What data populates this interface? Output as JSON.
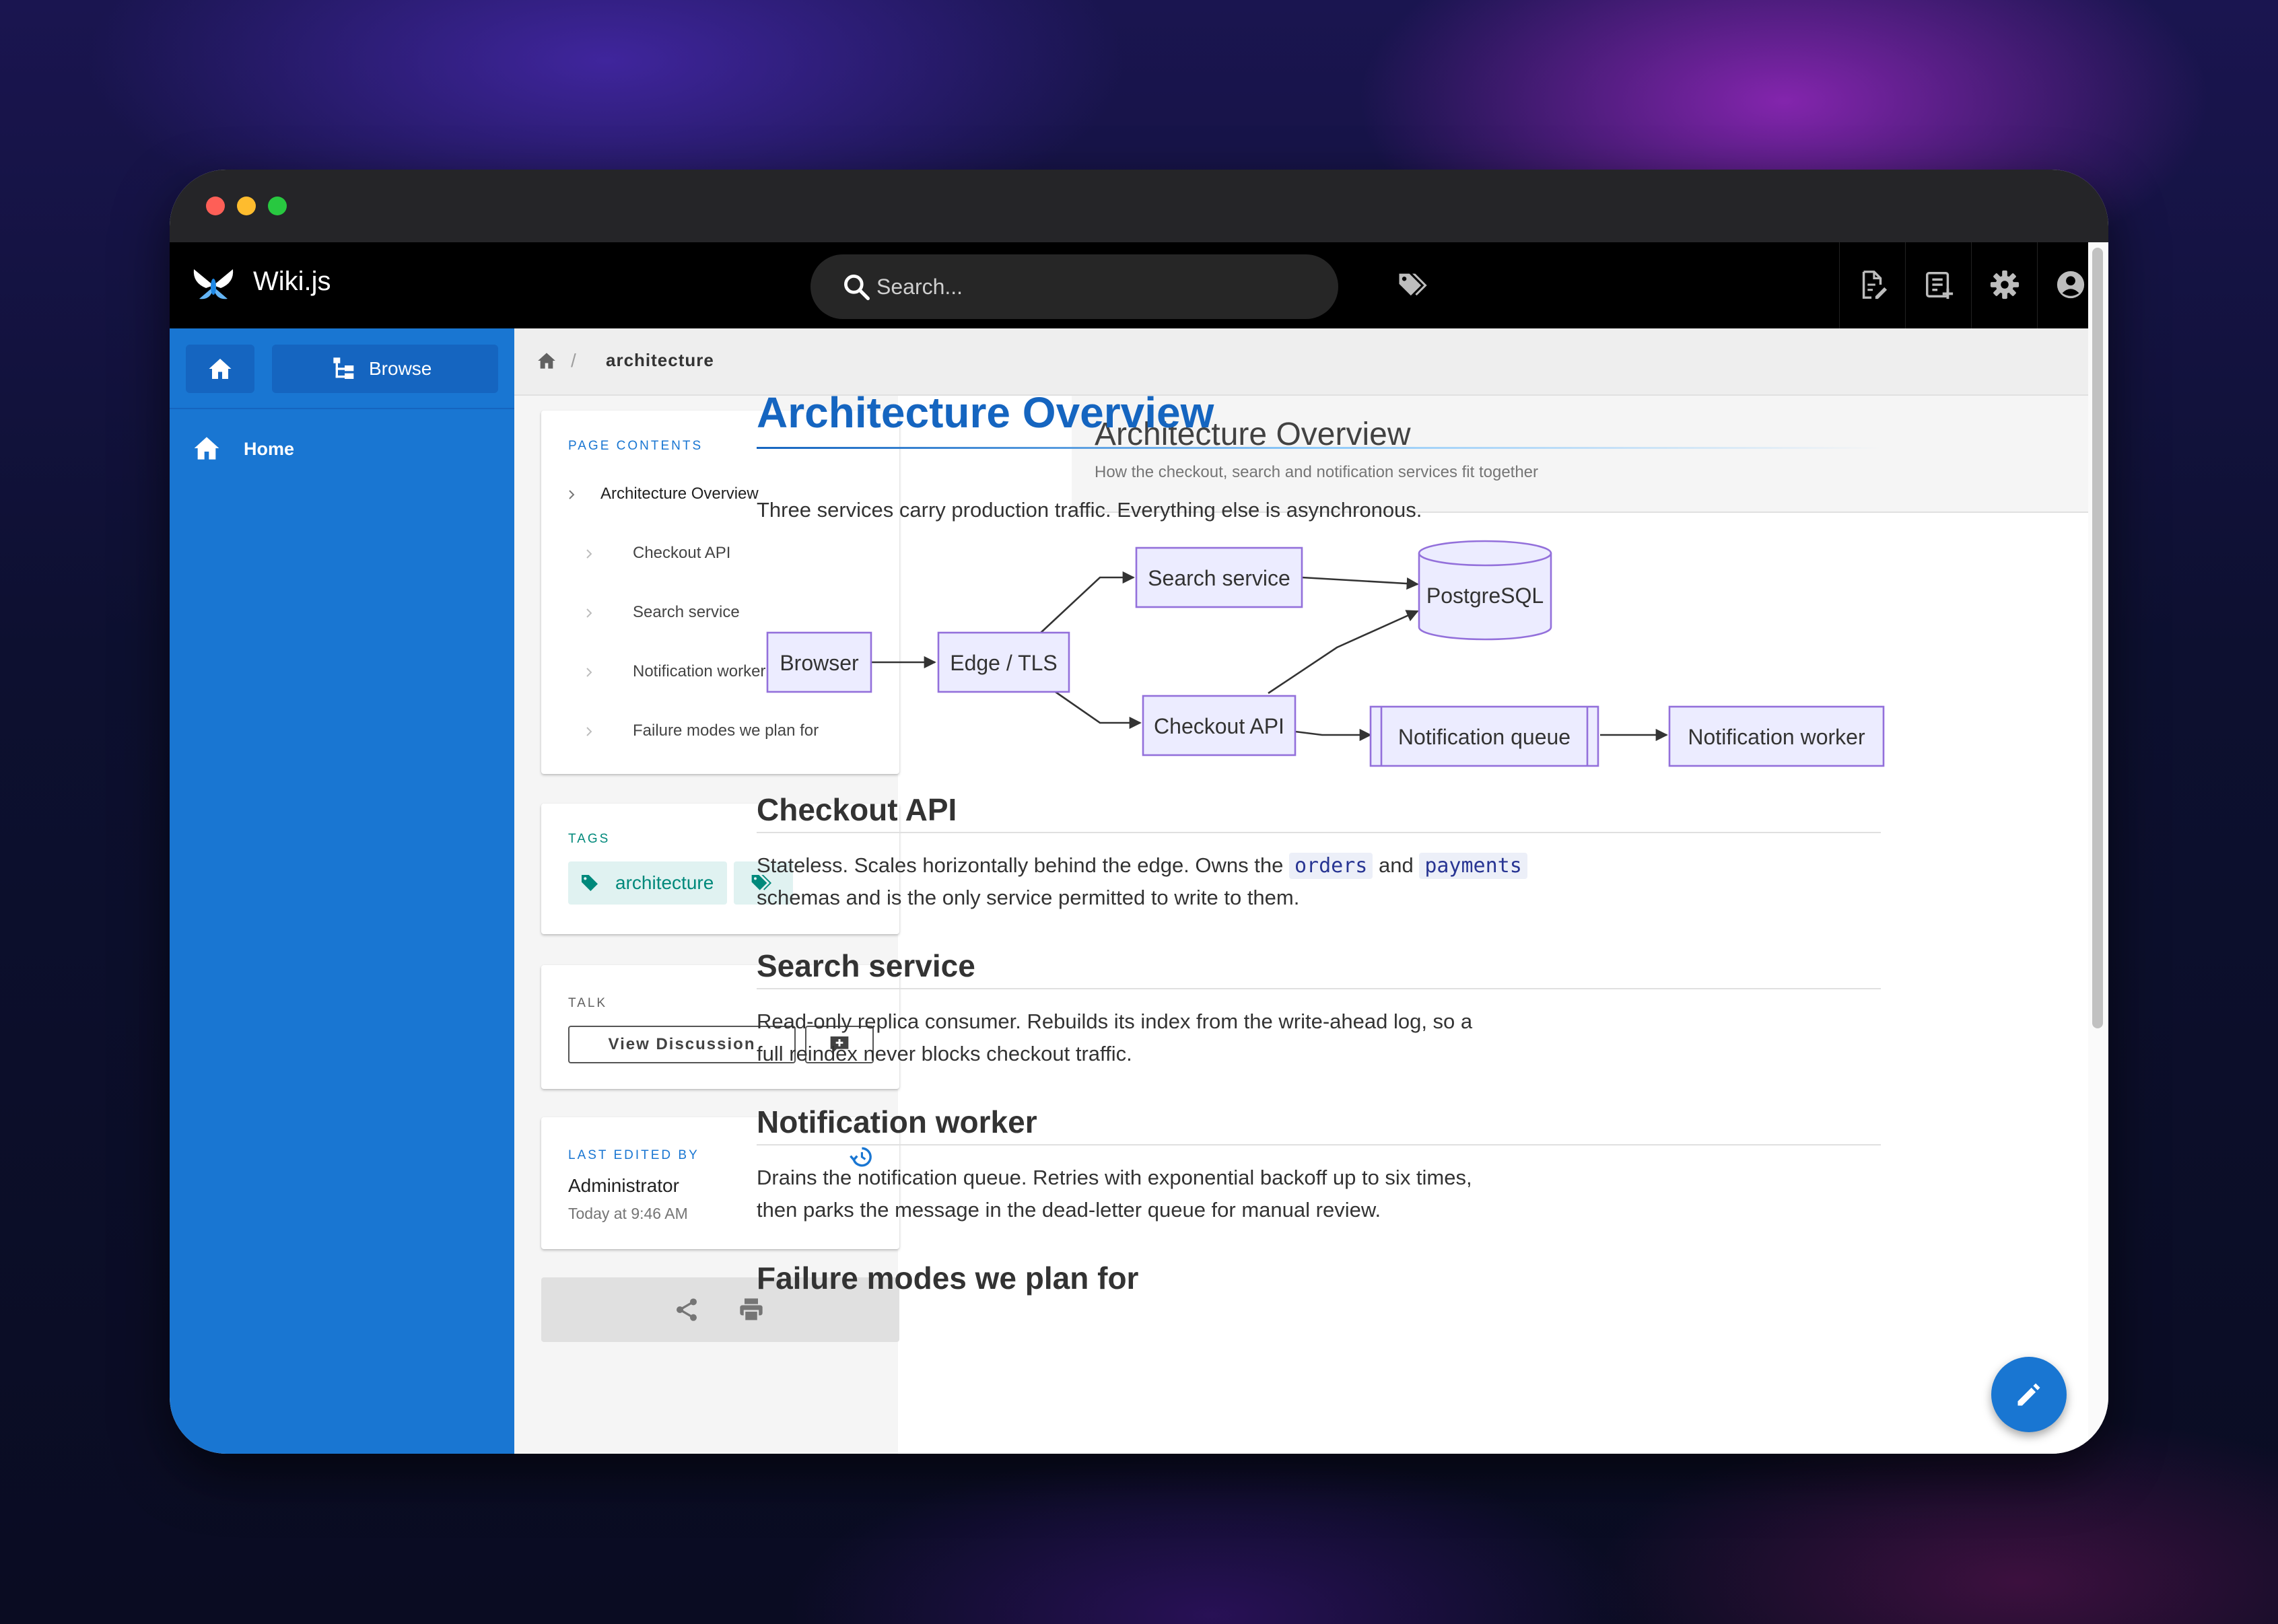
{
  "app": {
    "brand": "Wiki.js"
  },
  "search": {
    "placeholder": "Search..."
  },
  "sidebar": {
    "browse_label": "Browse",
    "items": [
      {
        "label": "Home",
        "icon": "home-icon"
      }
    ]
  },
  "breadcrumb": {
    "separator": "/",
    "current": "architecture"
  },
  "toc": {
    "title": "Page Contents",
    "items": [
      {
        "label": "Architecture Overview",
        "level": 1
      },
      {
        "label": "Checkout API",
        "level": 2
      },
      {
        "label": "Search service",
        "level": 2
      },
      {
        "label": "Notification worker",
        "level": 2
      },
      {
        "label": "Failure modes we plan for",
        "level": 2
      }
    ]
  },
  "tags": {
    "title": "Tags",
    "items": [
      "architecture"
    ]
  },
  "talk": {
    "title": "Talk",
    "button_label": "View Discussion"
  },
  "last_edited": {
    "title": "Last edited by",
    "author": "Administrator",
    "time": "Today at 9:46 AM"
  },
  "page": {
    "title": "Architecture Overview",
    "subtitle": "How the checkout, search and notification services fit together"
  },
  "article": {
    "h1": "Architecture Overview",
    "intro": "Three services carry production traffic. Everything else is asynchronous.",
    "diagram": {
      "nodes": {
        "browser": "Browser",
        "edge": "Edge / TLS",
        "search": "Search service",
        "checkout": "Checkout API",
        "postgres": "PostgreSQL",
        "queue": "Notification queue",
        "worker": "Notification worker"
      }
    },
    "sections": [
      {
        "heading": "Checkout API",
        "p1_pre": "Stateless. Scales horizontally behind the edge. Owns the ",
        "code1": "orders",
        "p1_mid": " and ",
        "code2": "payments",
        "p2": "schemas and is the only service permitted to write to them."
      },
      {
        "heading": "Search service",
        "p1": "Read-only replica consumer. Rebuilds its index from the write-ahead log, so a",
        "p2": "full reindex never blocks checkout traffic."
      },
      {
        "heading": "Notification worker",
        "p1": "Drains the notification queue. Retries with exponential backoff up to six times,",
        "p2": "then parks the message in the dead-letter queue for manual review."
      },
      {
        "heading": "Failure modes we plan for"
      }
    ]
  },
  "colors": {
    "sidebar": "#1976d2",
    "accent": "#1565c0",
    "tag_bg": "#e0f2f1",
    "tag_fg": "#00897b",
    "diagram_node_fill": "#ececff",
    "diagram_node_stroke": "#9370db"
  }
}
